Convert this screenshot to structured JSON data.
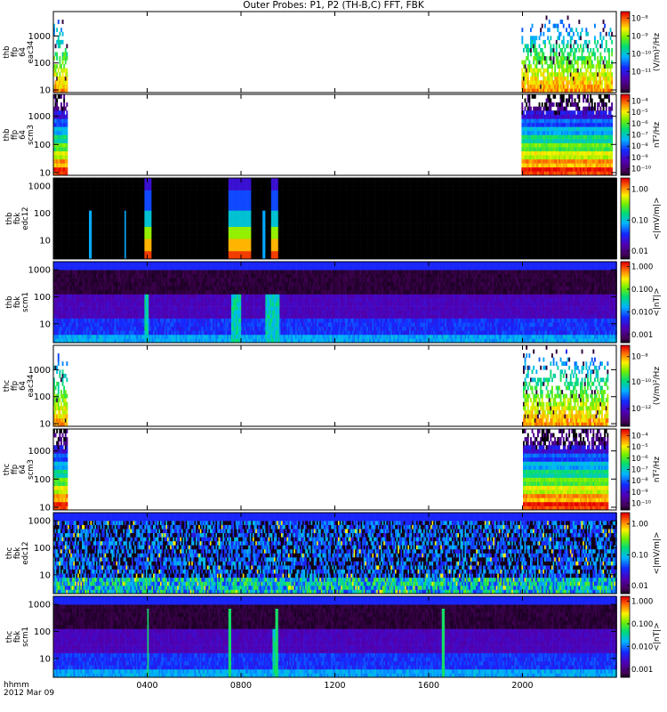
{
  "title": "Outer Probes: P1, P2 (TH-B,C) FFT, FBK",
  "footer": {
    "time_label": "hhmm",
    "date_label": "2012 Mar 09"
  },
  "chart_data": {
    "type": "heatmap",
    "x_axis": {
      "range_hours": [
        0,
        24
      ],
      "ticks": [
        "0400",
        "0800",
        "1200",
        "1600",
        "2000"
      ],
      "tick_hours": [
        4,
        8,
        12,
        16,
        20
      ]
    },
    "panels": [
      {
        "id": "thb-ffp-eac34",
        "ylabel": [
          "thb",
          "ffp",
          "64",
          "eac34"
        ],
        "yticks": [
          "10",
          "100",
          "1000"
        ],
        "ytick_values": [
          10,
          100,
          1000
        ],
        "ylog": true,
        "yrange": [
          8,
          8000
        ],
        "colorbar_title": "(V/m)²/Hz",
        "colorbar_ticks": [
          "10⁻⁸",
          "10⁻⁹",
          "10⁻¹⁰",
          "10⁻¹¹"
        ],
        "colorbar_positions": [
          0.92,
          0.7,
          0.48,
          0.26
        ],
        "coverage_hours": [
          [
            0,
            0.6
          ],
          [
            19.9,
            23.8
          ]
        ],
        "pattern": "spiky"
      },
      {
        "id": "thb-ffp-scm3",
        "ylabel": [
          "thb",
          "ffp",
          "64",
          "scm3"
        ],
        "yticks": [
          "10",
          "100",
          "1000"
        ],
        "ytick_values": [
          10,
          100,
          1000
        ],
        "ylog": true,
        "yrange": [
          8,
          6000
        ],
        "colorbar_title": "nT²/Hz",
        "colorbar_ticks": [
          "10⁻⁴",
          "10⁻⁵",
          "10⁻⁶",
          "10⁻⁷",
          "10⁻⁸",
          "10⁻⁹",
          "10⁻¹⁰"
        ],
        "colorbar_positions": [
          0.92,
          0.78,
          0.64,
          0.5,
          0.36,
          0.22,
          0.08
        ],
        "coverage_hours": [
          [
            0,
            0.6
          ],
          [
            19.9,
            23.8
          ]
        ],
        "pattern": "stripes"
      },
      {
        "id": "thb-fbk-edc12",
        "ylabel": [
          "thb",
          "fbk",
          "edc12"
        ],
        "yticks": [
          "10",
          "100",
          "1000"
        ],
        "ytick_values": [
          10,
          100,
          1000
        ],
        "ylog": true,
        "yrange": [
          2,
          2000
        ],
        "colorbar_title": "<|mV/m|>",
        "colorbar_ticks": [
          "1.00",
          "0.10",
          "0.01"
        ],
        "colorbar_positions": [
          0.86,
          0.48,
          0.1
        ],
        "coverage_hours": [
          [
            0,
            24
          ]
        ],
        "pattern": "bursts",
        "events_hours": [
          [
            3.85,
            4.15
          ],
          [
            7.45,
            8.4
          ],
          [
            9.25,
            9.55
          ]
        ],
        "isolated_lines_hours": [
          1.55,
          3.05,
          8.95
        ]
      },
      {
        "id": "thb-fbk-scm1",
        "ylabel": [
          "thb",
          "fbk",
          "scm1"
        ],
        "yticks": [
          "10",
          "100",
          "1000"
        ],
        "ytick_values": [
          10,
          100,
          1000
        ],
        "ylog": true,
        "yrange": [
          2,
          2000
        ],
        "colorbar_title": "<|nT|>",
        "colorbar_ticks": [
          "1.000",
          "0.100",
          "0.010",
          "0.001"
        ],
        "colorbar_positions": [
          0.94,
          0.66,
          0.38,
          0.1
        ],
        "coverage_hours": [
          [
            0,
            24
          ]
        ],
        "pattern": "bands",
        "events_hours": [
          [
            3.85,
            4.05
          ],
          [
            7.55,
            7.95
          ],
          [
            9.0,
            9.6
          ]
        ]
      },
      {
        "id": "thc-ffp-eac34",
        "ylabel": [
          "thc",
          "ffp",
          "64",
          "eac34"
        ],
        "yticks": [
          "10",
          "100",
          "1000"
        ],
        "ytick_values": [
          10,
          100,
          1000
        ],
        "ylog": true,
        "yrange": [
          8,
          8000
        ],
        "colorbar_title": "(V/m)²/Hz",
        "colorbar_ticks": [
          "10⁻⁸",
          "10⁻¹⁰",
          "10⁻¹²"
        ],
        "colorbar_positions": [
          0.86,
          0.55,
          0.22
        ],
        "coverage_hours": [
          [
            0,
            0.6
          ],
          [
            20.0,
            23.6
          ]
        ],
        "pattern": "spiky"
      },
      {
        "id": "thc-ffp-scm3",
        "ylabel": [
          "thc",
          "ffp",
          "64",
          "scm3"
        ],
        "yticks": [
          "10",
          "100",
          "1000"
        ],
        "ytick_values": [
          10,
          100,
          1000
        ],
        "ylog": true,
        "yrange": [
          8,
          6000
        ],
        "colorbar_title": "nT²/Hz",
        "colorbar_ticks": [
          "10⁻⁴",
          "10⁻⁵",
          "10⁻⁶",
          "10⁻⁷",
          "10⁻⁸",
          "10⁻⁹",
          "10⁻¹⁰"
        ],
        "colorbar_positions": [
          0.92,
          0.78,
          0.64,
          0.5,
          0.36,
          0.22,
          0.08
        ],
        "coverage_hours": [
          [
            0,
            0.6
          ],
          [
            20.0,
            23.6
          ]
        ],
        "pattern": "stripes"
      },
      {
        "id": "thc-fbk-edc12",
        "ylabel": [
          "thc",
          "fbk",
          "edc12"
        ],
        "yticks": [
          "10",
          "100",
          "1000"
        ],
        "ytick_values": [
          10,
          100,
          1000
        ],
        "ylog": true,
        "yrange": [
          2,
          2000
        ],
        "colorbar_title": "<|mV/m|>",
        "colorbar_ticks": [
          "1.00",
          "0.10",
          "0.01"
        ],
        "colorbar_positions": [
          0.86,
          0.48,
          0.1
        ],
        "coverage_hours": [
          [
            0,
            24
          ]
        ],
        "pattern": "dense"
      },
      {
        "id": "thc-fbk-scm1",
        "ylabel": [
          "thc",
          "fbk",
          "scm1"
        ],
        "yticks": [
          "10",
          "100",
          "1000"
        ],
        "ytick_values": [
          10,
          100,
          1000
        ],
        "ylog": true,
        "yrange": [
          2,
          2000
        ],
        "colorbar_title": "<|nT|>",
        "colorbar_ticks": [
          "1.000",
          "0.100",
          "0.010",
          "0.001"
        ],
        "colorbar_positions": [
          0.94,
          0.66,
          0.38,
          0.1
        ],
        "coverage_hours": [
          [
            0,
            24
          ]
        ],
        "pattern": "bands",
        "events_hours": [
          [
            9.3,
            9.45
          ]
        ],
        "isolated_lines_hours": [
          4.0,
          7.5,
          9.5,
          16.6
        ]
      }
    ]
  }
}
